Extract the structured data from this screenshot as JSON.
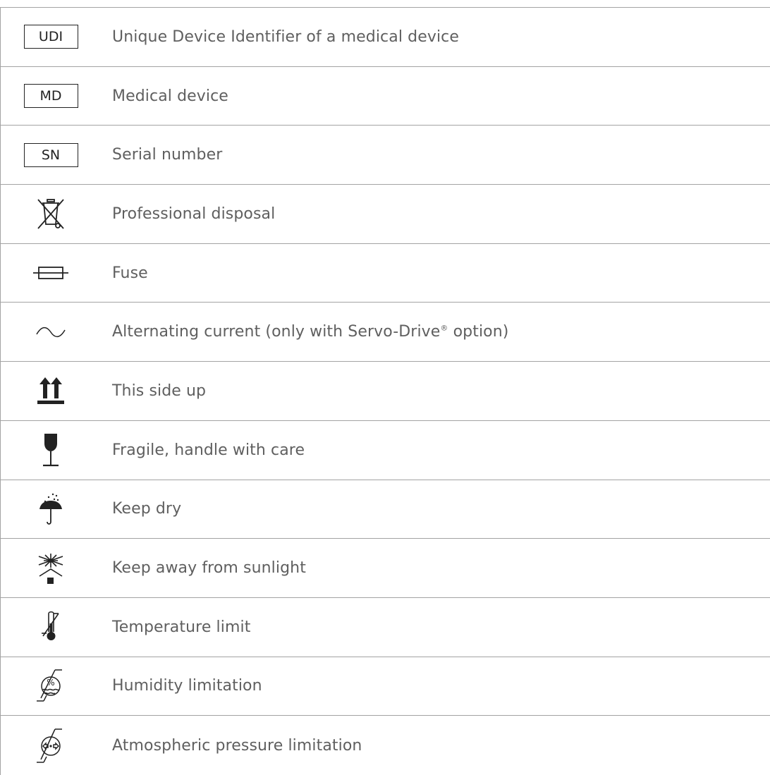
{
  "rows": [
    {
      "icon": "udi-box-icon",
      "symbol_text": "UDI",
      "label": "Unique Device Identifier of a medical device"
    },
    {
      "icon": "md-box-icon",
      "symbol_text": "MD",
      "label": "Medical device"
    },
    {
      "icon": "sn-box-icon",
      "symbol_text": "SN",
      "label": "Serial number"
    },
    {
      "icon": "crossed-bin-icon",
      "label": "Professional disposal"
    },
    {
      "icon": "fuse-icon",
      "label": "Fuse"
    },
    {
      "icon": "alternating-current-icon",
      "label_pre": "Alternating current (only with Servo-Drive",
      "label_reg": "®",
      "label_post": " option)"
    },
    {
      "icon": "this-side-up-icon",
      "label": "This side up"
    },
    {
      "icon": "fragile-glass-icon",
      "label": "Fragile, handle with care"
    },
    {
      "icon": "keep-dry-umbrella-icon",
      "label": "Keep dry"
    },
    {
      "icon": "keep-away-sunlight-icon",
      "label": "Keep away from sunlight"
    },
    {
      "icon": "temperature-limit-icon",
      "label": "Temperature limit"
    },
    {
      "icon": "humidity-limit-icon",
      "label": "Humidity limitation"
    },
    {
      "icon": "pressure-limit-icon",
      "label": "Atmospheric pressure limitation"
    }
  ]
}
